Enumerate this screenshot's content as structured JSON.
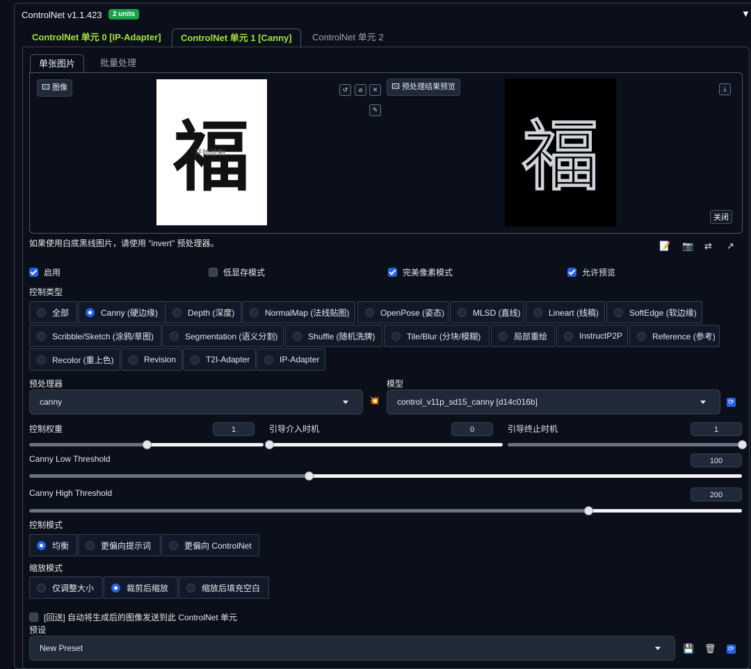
{
  "header": {
    "title": "ControlNet v1.1.423",
    "badge": "2 units",
    "collapse_icon": "▼"
  },
  "unit_tabs": [
    {
      "label": "ControlNet 单元 0 [IP-Adapter]"
    },
    {
      "label": "ControlNet 单元 1 [Canny]"
    },
    {
      "label": "ControlNet 单元 2"
    }
  ],
  "sub_tabs": [
    {
      "label": "单张图片"
    },
    {
      "label": "批量处理"
    }
  ],
  "image_panel": {
    "image_label": "图像",
    "canvas_overlay": "开始绘制",
    "preview_label": "预处理结果预览",
    "close_label": "关闭",
    "glyph": "福"
  },
  "hint": "如果使用白底黑线图片，请使用 \"invert\" 预处理器。",
  "checkboxes": [
    {
      "label": "启用",
      "checked": true
    },
    {
      "label": "低显存模式",
      "checked": false
    },
    {
      "label": "完美像素模式",
      "checked": true
    },
    {
      "label": "允许预览",
      "checked": true
    }
  ],
  "control_type": {
    "label": "控制类型",
    "options": [
      "全部",
      "Canny (硬边缘)",
      "Depth (深度)",
      "NormalMap (法线贴图)",
      "OpenPose (姿态)",
      "MLSD (直线)",
      "Lineart (线稿)",
      "SoftEdge (软边缘)",
      "Scribble/Sketch (涂鸦/草图)",
      "Segmentation (语义分割)",
      "Shuffle (随机洗牌)",
      "Tile/Blur (分块/模糊)",
      "局部重绘",
      "InstructP2P",
      "Reference (参考)",
      "Recolor (重上色)",
      "Revision",
      "T2I-Adapter",
      "IP-Adapter"
    ],
    "selected": "Canny (硬边缘)"
  },
  "preprocessor": {
    "label": "预处理器",
    "value": "canny"
  },
  "model": {
    "label": "模型",
    "value": "control_v11p_sd15_canny [d14c016b]"
  },
  "sliders": {
    "weight": {
      "label": "控制权重",
      "value": "1",
      "fraction": 0.5
    },
    "start": {
      "label": "引导介入时机",
      "value": "0",
      "fraction": 0.0
    },
    "end": {
      "label": "引导终止时机",
      "value": "1",
      "fraction": 1.0
    },
    "low": {
      "label": "Canny Low Threshold",
      "value": "100",
      "fraction": 0.392
    },
    "high": {
      "label": "Canny High Threshold",
      "value": "200",
      "fraction": 0.784
    }
  },
  "control_mode": {
    "label": "控制模式",
    "options": [
      "均衡",
      "更偏向提示词",
      "更偏向 ControlNet"
    ],
    "selected": "均衡"
  },
  "resize_mode": {
    "label": "缩放模式",
    "options": [
      "仅调整大小",
      "裁剪后缩放",
      "缩放后填充空白"
    ],
    "selected": "裁剪后缩放"
  },
  "loopback": {
    "label": "[回送] 自动将生成后的图像发送到此 ControlNet 单元",
    "checked": false
  },
  "preset": {
    "label": "预设",
    "value": "New Preset"
  },
  "icons": {
    "explosion": "💥",
    "refresh": "⟳",
    "save": "💾",
    "trash": "🗑"
  }
}
